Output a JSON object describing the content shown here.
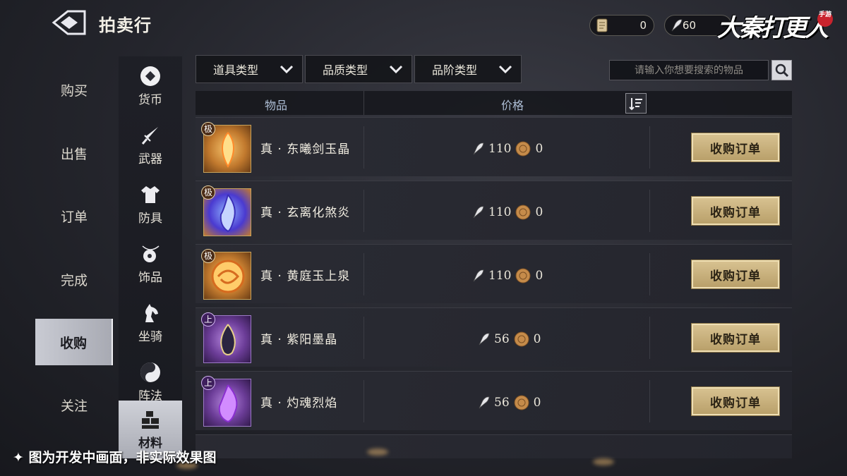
{
  "header": {
    "title": "拍卖行",
    "currencies": [
      {
        "icon": "scroll-ticket-icon",
        "value": "0"
      },
      {
        "icon": "feather-token-icon",
        "value": "60"
      }
    ],
    "logo": "大秦打更人",
    "logo_badge": "手游"
  },
  "sidebar": {
    "items": [
      {
        "label": "购买"
      },
      {
        "label": "出售"
      },
      {
        "label": "订单"
      },
      {
        "label": "完成"
      },
      {
        "label": "收购",
        "active": true
      },
      {
        "label": "关注"
      }
    ]
  },
  "categories": [
    {
      "label": "货币",
      "icon": "coin-icon"
    },
    {
      "label": "武器",
      "icon": "sword-icon"
    },
    {
      "label": "防具",
      "icon": "armor-icon"
    },
    {
      "label": "饰品",
      "icon": "pendant-icon"
    },
    {
      "label": "坐骑",
      "icon": "horse-icon"
    },
    {
      "label": "阵法",
      "icon": "formation-icon"
    },
    {
      "label": "材料",
      "icon": "material-icon",
      "active": true
    }
  ],
  "filters": [
    {
      "label": "道具类型"
    },
    {
      "label": "品质类型"
    },
    {
      "label": "品阶类型"
    }
  ],
  "search": {
    "placeholder": "请输入你想要搜索的物品"
  },
  "table": {
    "headers": {
      "item": "物品",
      "price": "价格"
    },
    "rows": [
      {
        "grade": "极",
        "name": "真 · 东曦剑玉晶",
        "price": "110",
        "coin": "0",
        "button": "收购订单",
        "quality": "gold"
      },
      {
        "grade": "极",
        "name": "真 · 玄离化煞炎",
        "price": "110",
        "coin": "0",
        "button": "收购订单",
        "quality": "gold"
      },
      {
        "grade": "极",
        "name": "真 · 黄庭玉上泉",
        "price": "110",
        "coin": "0",
        "button": "收购订单",
        "quality": "gold"
      },
      {
        "grade": "上",
        "name": "真 · 紫阳墨晶",
        "price": "56",
        "coin": "0",
        "button": "收购订单",
        "quality": "purple"
      },
      {
        "grade": "上",
        "name": "真 · 灼魂烈焰",
        "price": "56",
        "coin": "0",
        "button": "收购订单",
        "quality": "purple"
      }
    ]
  },
  "footer": {
    "note": "✦ 图为开发中画面，非实际效果图"
  },
  "colors": {
    "accent_gold": "#d7c190",
    "active_nav": "#c9cbd3",
    "panel": "#2a2b33"
  }
}
